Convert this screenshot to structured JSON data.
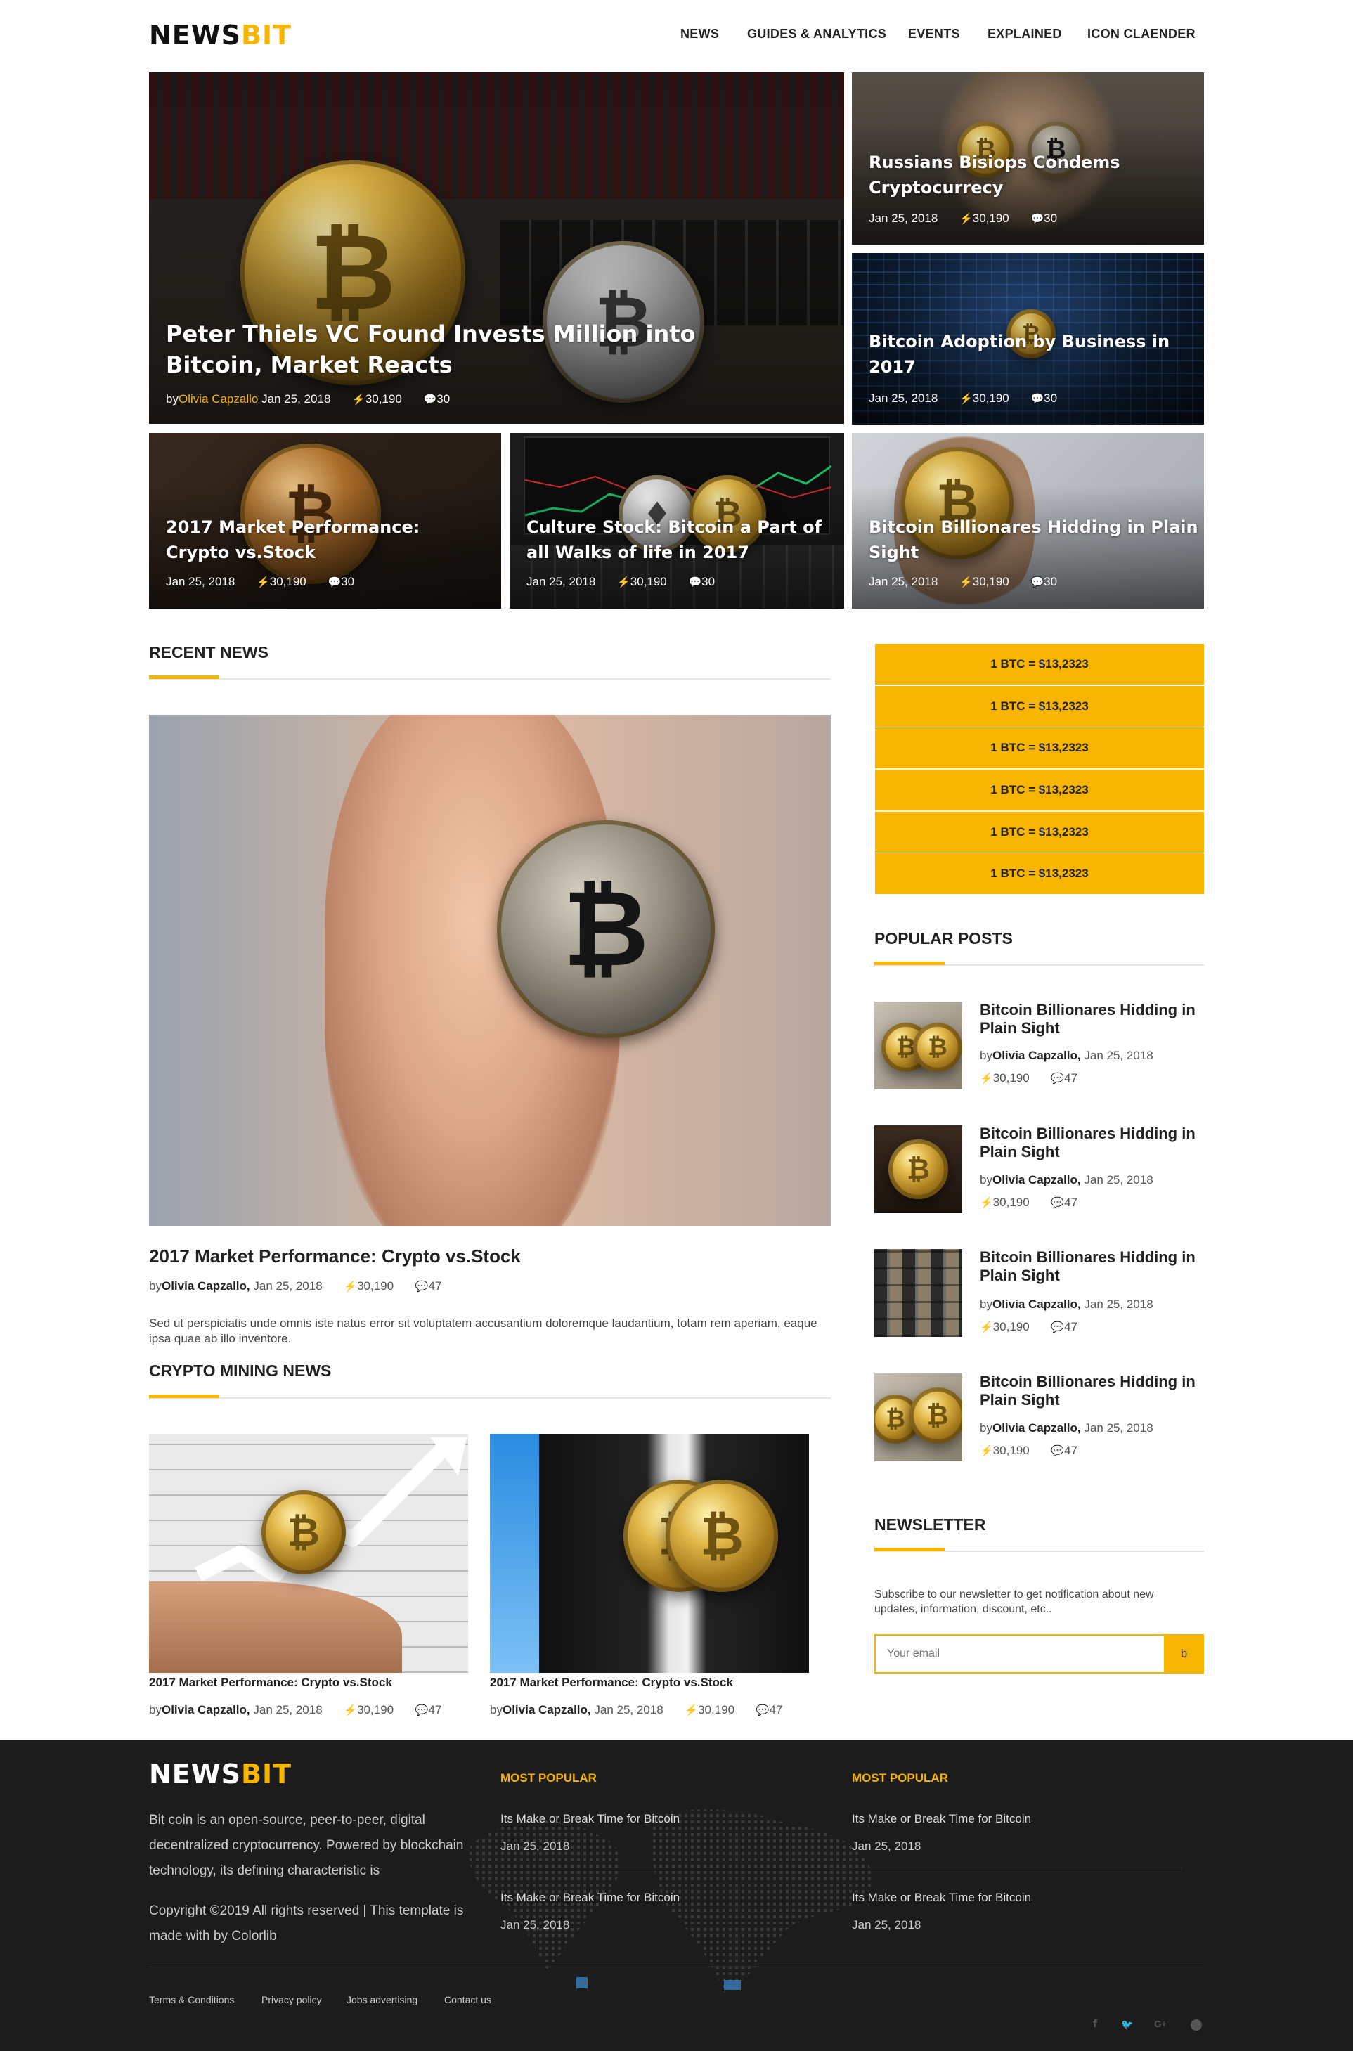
{
  "brand": {
    "part1": "NEWS",
    "part2": "BIT"
  },
  "nav": [
    "NEWS",
    "GUIDES & ANALYTICS",
    "EVENTS",
    "EXPLAINED",
    "ICON CLAENDER"
  ],
  "hero": {
    "main": {
      "title": "Peter Thiels VC Found Invests Million into Bitcoin, Market Reacts",
      "by": "by",
      "author": "Olivia Capzallo",
      "date": "Jan 25, 2018",
      "views": "30,190",
      "comments": "30"
    },
    "side1": {
      "title": "Russians Bisiops Condems Cryptocurrecy",
      "date": "Jan 25, 2018",
      "views": "30,190",
      "comments": "30"
    },
    "side2": {
      "title": "Bitcoin Adoption by Business in 2017",
      "date": "Jan 25, 2018",
      "views": "30,190",
      "comments": "30"
    },
    "bottom": [
      {
        "title": "2017 Market Performance: Crypto vs.Stock",
        "date": "Jan 25, 2018",
        "views": "30,190",
        "comments": "30"
      },
      {
        "title": "Culture Stock: Bitcoin a Part of all Walks of life in 2017",
        "date": "Jan 25, 2018",
        "views": "30,190",
        "comments": "30"
      },
      {
        "title": "Bitcoin Billionares Hidding in Plain Sight",
        "date": "Jan 25, 2018",
        "views": "30,190",
        "comments": "30"
      }
    ]
  },
  "recent": {
    "heading": "RECENT NEWS",
    "title": "2017 Market Performance: Crypto vs.Stock",
    "by": "by",
    "author": "Olivia Capzallo,",
    "date": "Jan 25, 2018",
    "views": "30,190",
    "comments": "47",
    "excerpt": "Sed ut perspiciatis unde omnis iste natus error sit voluptatem accusantium doloremque laudantium, totam rem aperiam, eaque ipsa quae ab illo inventore."
  },
  "mining": {
    "heading": "CRYPTO MINING NEWS",
    "posts": [
      {
        "title": "2017 Market Performance: Crypto vs.Stock",
        "by": "by",
        "author": "Olivia Capzallo,",
        "date": "Jan 25, 2018",
        "views": "30,190",
        "comments": "47"
      },
      {
        "title": "2017 Market Performance: Crypto vs.Stock",
        "by": "by",
        "author": "Olivia Capzallo,",
        "date": "Jan 25, 2018",
        "views": "30,190",
        "comments": "47"
      }
    ]
  },
  "prices": [
    "1 BTC = $13,2323",
    "1 BTC = $13,2323",
    "1 BTC = $13,2323",
    "1 BTC = $13,2323",
    "1 BTC = $13,2323",
    "1 BTC = $13,2323"
  ],
  "popular": {
    "heading": "POPULAR POSTS",
    "posts": [
      {
        "title": "Bitcoin Billionares Hidding in Plain Sight",
        "by": "by",
        "author": "Olivia Capzallo,",
        "date": "Jan 25, 2018",
        "views": "30,190",
        "comments": "47"
      },
      {
        "title": "Bitcoin Billionares Hidding in Plain Sight",
        "by": "by",
        "author": "Olivia Capzallo,",
        "date": "Jan 25, 2018",
        "views": "30,190",
        "comments": "47"
      },
      {
        "title": "Bitcoin Billionares Hidding in Plain Sight",
        "by": "by",
        "author": "Olivia Capzallo,",
        "date": "Jan 25, 2018",
        "views": "30,190",
        "comments": "47"
      },
      {
        "title": "Bitcoin Billionares Hidding in Plain Sight",
        "by": "by",
        "author": "Olivia Capzallo,",
        "date": "Jan 25, 2018",
        "views": "30,190",
        "comments": "47"
      }
    ]
  },
  "newsletter": {
    "heading": "NEWSLETTER",
    "text": "Subscribe to our newsletter to get notification about new updates, information, discount, etc..",
    "placeholder": "Your email",
    "button": "b"
  },
  "footer": {
    "about": "Bit coin is an open-source, peer-to-peer, digital decentralized cryptocurrency. Powered by blockchain technology, its defining characteristic is",
    "copyright": "Copyright ©2019 All rights reserved | This template is made with by Colorlib",
    "col1": {
      "heading": "MOST POPULAR",
      "items": [
        {
          "title": "Its Make or Break Time for Bitcoin",
          "date": "Jan 25, 2018"
        },
        {
          "title": "Its Make or Break Time for Bitcoin",
          "date": "Jan 25, 2018"
        }
      ]
    },
    "col2": {
      "heading": "MOST POPULAR",
      "items": [
        {
          "title": "Its Make or Break Time for Bitcoin",
          "date": "Jan 25, 2018"
        },
        {
          "title": "Its Make or Break Time for Bitcoin",
          "date": "Jan 25, 2018"
        }
      ]
    },
    "links": [
      "Terms & Conditions",
      "Privacy policy",
      "Jobs advertising",
      "Contact us"
    ],
    "social": [
      "facebook-icon",
      "twitter-icon",
      "google-plus-icon",
      "dribbble-icon"
    ]
  },
  "colors": {
    "accent": "#f7b500",
    "footer_bg": "#1c1c1c"
  }
}
